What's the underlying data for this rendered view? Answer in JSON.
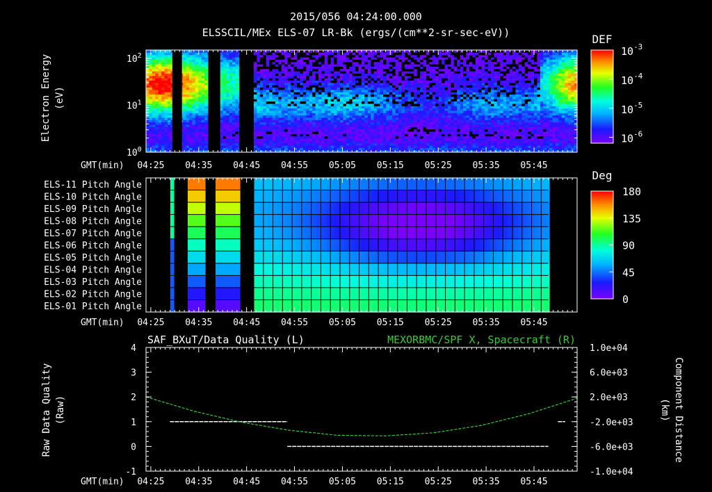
{
  "header": {
    "line1": "2015/056 04:24:00.000",
    "line2": "ELSSCIL/MEx ELS-07 LR-Bk  (ergs/(cm**2-sr-sec-eV))"
  },
  "time_axis": {
    "label": "GMT(min)",
    "ticks": [
      "04:25",
      "04:35",
      "04:45",
      "04:55",
      "05:05",
      "05:15",
      "05:25",
      "05:35",
      "05:45"
    ]
  },
  "chart_data": [
    {
      "type": "heatmap",
      "title": "ELSSCIL/MEx ELS-07 LR-Bk  (ergs/(cm**2-sr-sec-eV))",
      "ylabel": "Electron Energy (eV)",
      "ylabel_lines": [
        "Electron Energy",
        "(eV)"
      ],
      "y_scale": "log",
      "ylim": [
        1,
        150
      ],
      "y_ticks": [
        {
          "base": "10",
          "exp": "0",
          "value": 1
        },
        {
          "base": "10",
          "exp": "1",
          "value": 10
        },
        {
          "base": "10",
          "exp": "2",
          "value": 100
        }
      ],
      "xlim_minutes": [
        0,
        90
      ],
      "colorbar": {
        "label": "DEF",
        "log_range": [
          -6.2,
          -3
        ],
        "ticks": [
          {
            "base": "10",
            "exp": "-3",
            "value": -3
          },
          {
            "base": "10",
            "exp": "-4",
            "value": -4
          },
          {
            "base": "10",
            "exp": "-5",
            "value": -5
          },
          {
            "base": "10",
            "exp": "-6",
            "value": -6
          }
        ]
      },
      "data_gaps_minutes": [
        [
          5.5,
          7.5
        ],
        [
          13,
          15.5
        ],
        [
          19.5,
          22.5
        ]
      ],
      "notes": "Peak flux near 30 eV around 04:24-04:36 and 05:50-05:54; weaker ~10 eV band elsewhere"
    },
    {
      "type": "heatmap",
      "title": "",
      "rows": [
        "ELS-11 Pitch Angle",
        "ELS-10 Pitch Angle",
        "ELS-09 Pitch Angle",
        "ELS-08 Pitch Angle",
        "ELS-07 Pitch Angle",
        "ELS-06 Pitch Angle",
        "ELS-05 Pitch Angle",
        "ELS-04 Pitch Angle",
        "ELS-03 Pitch Angle",
        "ELS-02 Pitch Angle",
        "ELS-01 Pitch Angle"
      ],
      "unit": "Deg",
      "colorbar": {
        "label": "Deg",
        "range": [
          0,
          180
        ],
        "ticks": [
          "180",
          "135",
          "90",
          "45",
          "0"
        ]
      },
      "data_minutes": [
        5,
        84
      ],
      "data_gaps_minutes": [
        [
          6,
          8.5
        ],
        [
          12.7,
          14.5
        ],
        [
          19.5,
          22.5
        ]
      ],
      "notes": "Pitch angle ~90 deg overall; minimum ~20 deg near ELS-07/08 around 05:15-05:25; ELS-11 ~150 deg early on"
    },
    {
      "type": "line",
      "title_left": "SAF_BXuT/Data Quality (L)",
      "title_right": "MEXORBMC/SPF X, Spacecraft (R)",
      "ylabel_left_lines": [
        "Raw Data Quality",
        "(Raw)"
      ],
      "ylabel_right_lines": [
        "Component Distance",
        "(km)"
      ],
      "ylim_left": [
        -1,
        4
      ],
      "y_ticks_left": [
        "4",
        "3",
        "2",
        "1",
        "0",
        "-1"
      ],
      "ylim_right": [
        -10000,
        10000
      ],
      "y_ticks_right": [
        "1.0e+04",
        "6.0e+03",
        "2.0e+03",
        "-2.0e+03",
        "-6.0e+03",
        "-1.0e+04"
      ],
      "series": [
        {
          "name": "SAF_BXuT/Data Quality (L)",
          "color": "#ffffff",
          "axis": "left",
          "segments": [
            {
              "x": [
                5,
                29.5
              ],
              "y": [
                1,
                1
              ]
            },
            {
              "x": [
                29.5,
                84
              ],
              "y": [
                0,
                0
              ]
            },
            {
              "x": [
                86,
                87.5
              ],
              "y": [
                1,
                1
              ]
            }
          ]
        },
        {
          "name": "MEXORBMC/SPF X, Spacecraft (R)",
          "color": "#33cc33",
          "axis": "right",
          "x": [
            0,
            10,
            20,
            30,
            40,
            50,
            60,
            70,
            80,
            90
          ],
          "y": [
            2000,
            -300,
            -2100,
            -3400,
            -4200,
            -4300,
            -3800,
            -2600,
            -700,
            1800
          ]
        }
      ]
    }
  ]
}
